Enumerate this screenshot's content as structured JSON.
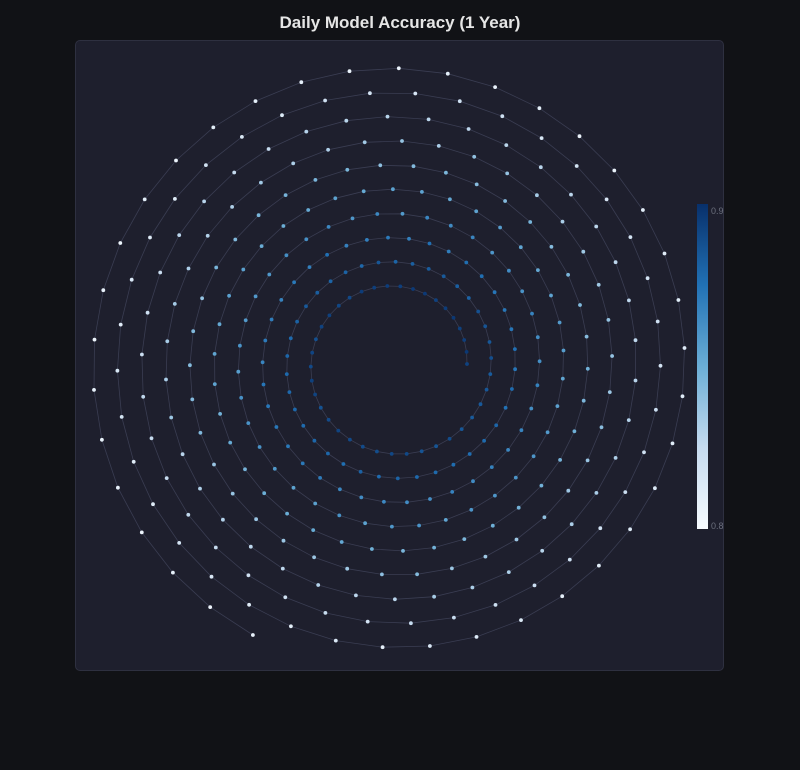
{
  "title": "Daily Model Accuracy (1 Year)",
  "chart_data": {
    "type": "scatter",
    "subtype": "spiral",
    "title": "Daily Model Accuracy (1 Year)",
    "series": [
      {
        "n_points": 365,
        "x_start_day": 1,
        "x_end_day": 365,
        "accuracy_profile": "highest (~0.895) near the spiral center, declining to ~0.805 at the outer end",
        "value_range": [
          0.805,
          0.897
        ]
      }
    ],
    "colorscale": [
      "#f7fbff",
      "#c6dbef",
      "#6baed6",
      "#2171b5",
      "#08306b"
    ],
    "colorbar": {
      "min": 0.8,
      "max": 0.9,
      "tick_labels": [
        "0.9",
        "0.8"
      ],
      "placement": "right"
    },
    "grid": true,
    "legend": "none"
  }
}
